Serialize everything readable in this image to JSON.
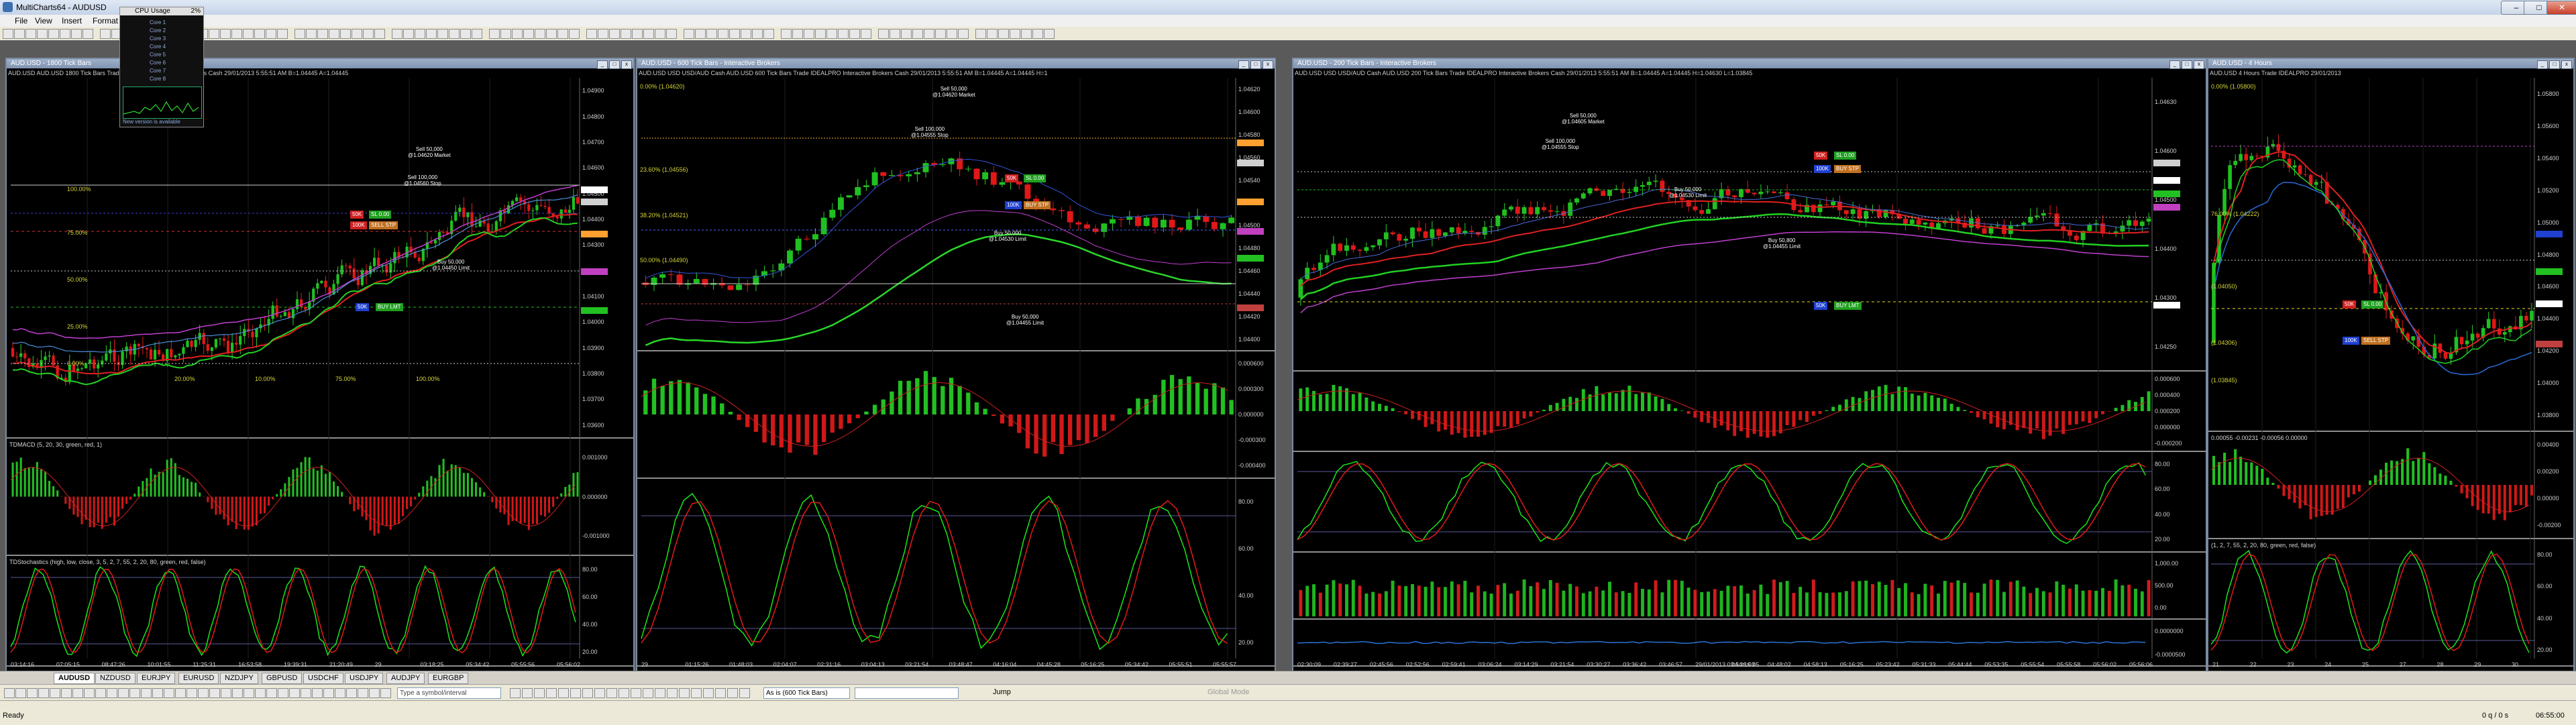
{
  "window": {
    "title": "MultiCharts64 - AUDUSD",
    "min": "–",
    "max": "□",
    "close": "✕"
  },
  "menu": [
    "File",
    "View",
    "Insert",
    "Format"
  ],
  "cpu": {
    "title": "CPU Usage",
    "percent": "2%",
    "rows": [
      "Core 1",
      "Core 2",
      "Core 3",
      "Core 4",
      "Core 5",
      "Core 6",
      "Core 7",
      "Core 8"
    ],
    "footer": "New version is available"
  },
  "charts": [
    {
      "title": "AUD.USD - 1800 Tick Bars",
      "info": "AUD.USD  AUD.USD  1800 Tick Bars   Trade  IDEALPRO  Interactive Brokers  Cash  29/01/2013  5:55:51 AM  B=1.04445  A=1.04445",
      "axis": [
        "1.04900",
        "1.04800",
        "1.04700",
        "1.04600",
        "1.04500",
        "1.04400",
        "1.04300",
        "1.04200",
        "1.04100",
        "1.04000",
        "1.03900",
        "1.03800",
        "1.03700",
        "1.03600"
      ],
      "fib": [
        "100.00%",
        "75.00%",
        "50.00%",
        "25.00%",
        "0.00%"
      ],
      "fibx": [
        "20.00%",
        "10.00%",
        "75.00%",
        "100.00%"
      ],
      "orders": [
        {
          "t": "Sell 50,000",
          "s": "@1.04620 Market"
        },
        {
          "t": "Sell 100,000",
          "s": "@1.04560 Stop"
        },
        {
          "t": "Buy 50,000",
          "s": "@1.04450 Limit"
        }
      ],
      "times": [
        "03:14:16",
        "07:05:15",
        "08:47:26",
        "10:01:55",
        "11:25:31",
        "16:53:58",
        "19:39:31",
        "21:20:49",
        "29",
        "03:18:25",
        "05:34:42",
        "05:55:56",
        "05:56:02"
      ],
      "ind1": "TDMACD (5, 20, 30, green, red, 1)",
      "ind1axis": [
        "0.001000",
        "0.000000",
        "-0.001000"
      ],
      "ind2": "TDStochastics (high, low, close, 3, 5, 2, 7, 55, 2, 20, 80, green, red, false)",
      "ind2axis": [
        "80.00",
        "60.00",
        "40.00",
        "20.00"
      ]
    },
    {
      "title": "AUD.USD - 600 Tick Bars - Interactive Brokers",
      "info": "AUD.USD  USD USD/AUD Cash AUD.USD  600 Tick Bars   Trade  IDEALPRO  Interactive Brokers  Cash  29/01/2013  5:55:51 AM  B=1.04445  A=1.04445  H=1",
      "axis": [
        "1.04620",
        "1.04600",
        "1.04580",
        "1.04560",
        "1.04540",
        "1.04520",
        "1.04500",
        "1.04480",
        "1.04460",
        "1.04440",
        "1.04420",
        "1.04400"
      ],
      "fib": [
        "0.00% (1.04620)",
        "23.60% (1.04556)",
        "38.20% (1.04521)",
        "50.00% (1.04490)"
      ],
      "orders": [
        {
          "t": "Sell 50,000",
          "s": "@1.04620 Market"
        },
        {
          "t": "Sell 100,000",
          "s": "@1.04555 Stop"
        },
        {
          "t": "Buy 50,000",
          "s": "@1.04530 Limit"
        },
        {
          "t": "Buy 50,000",
          "s": "@1.04455 Limit"
        }
      ],
      "times": [
        "29",
        "01:15:26",
        "01:48:03",
        "02:04:07",
        "02:31:16",
        "03:04:13",
        "03:21:54",
        "03:48:47",
        "04:16:04",
        "04:45:28",
        "05:16:25",
        "05:34:42",
        "05:55:51",
        "05:55:57"
      ],
      "ind1axis": [
        "0.000600",
        "0.000300",
        "0.000000",
        "-0.000300",
        "-0.000400"
      ],
      "ind2axis": [
        "80.00",
        "60.00",
        "40.00",
        "20.00"
      ]
    },
    {
      "title": "AUD.USD - 200 Tick Bars - Interactive Brokers",
      "info": "AUD.USD  USD USD/AUD Cash AUD.USD  200 Tick Bars   Trade  IDEALPRO  Interactive Brokers  Cash  29/01/2013  5:55:51 AM  B=1.04445  A=1.04445  H=1.04630  L=1.03845",
      "axis": [
        "1.04630",
        "1.04600",
        "1.04500",
        "1.04400",
        "1.04300",
        "1.04250"
      ],
      "orders": [
        {
          "t": "Sell 50,000",
          "s": "@1.04605 Market"
        },
        {
          "t": "Sell 100,000",
          "s": "@1.04555 Stop"
        },
        {
          "t": "Buy 50,000",
          "s": "@1.04530 Limit"
        },
        {
          "t": "Buy 50,800",
          "s": "@1.04455 Limit"
        }
      ],
      "times": [
        "02:30:09",
        "02:39:27",
        "02:45:56",
        "02:52:56",
        "02:59:41",
        "03:06:24",
        "03:14:29",
        "03:21:54",
        "03:30:27",
        "03:36:42",
        "03:46:57",
        "29/01/2013 03:54:16 05",
        "04:36:03",
        "04:48:02",
        "04:58:13",
        "05:16:25",
        "05:23:42",
        "05:31:33",
        "05:44:44",
        "05:53:35",
        "05:55:54",
        "05:55:58",
        "05:56:02",
        "05:56:06"
      ],
      "ind1axis": [
        "0.000600",
        "0.000400",
        "0.000200",
        "0.000000",
        "-0.000200"
      ],
      "ind2axis": [
        "80.00",
        "60.00",
        "40.00",
        "20.00"
      ],
      "ind3axis": [
        "1,000.00",
        "500.00",
        "0.00"
      ],
      "ind4axis": [
        "0.0000000",
        "-0.0000500"
      ]
    },
    {
      "title": "AUD.USD - 4 Hours",
      "info": "AUD.USD  4 Hours  Trade  IDEALPRO  29/01/2013",
      "axis": [
        "1.05800",
        "1.05600",
        "1.05400",
        "1.05200",
        "1.05000",
        "1.04800",
        "1.04600",
        "1.04400",
        "1.04200",
        "1.04000",
        "1.03800"
      ],
      "fib": [
        "0.00% (1.05800)",
        "76.00% (1.04222)",
        "(1.04050)",
        "(1.04306)",
        "(1.03845)"
      ],
      "ind1": "0.00055  -0.00231  -0.00056  0.00000",
      "ind1axis": [
        "0.00400",
        "0.00200",
        "0.00000",
        "-0.00200"
      ],
      "ind2": "(1, 2, 7, 55, 2, 20, 80, green, red, false)",
      "ind2axis": [
        "80.00",
        "60.00",
        "40.00",
        "20.00"
      ],
      "times": [
        "21",
        "22",
        "23",
        "24",
        "25",
        "27",
        "28",
        "29",
        "30"
      ]
    }
  ],
  "order_tags": {
    "sl": "SL",
    "tp": "TP",
    "qty": "50K",
    "qty2": "100K",
    "buy_stp": "BUY STP",
    "buy_lmt": "BUY LMT",
    "sell_stp": "SELL STP",
    "sell_lmt": "SELL LMT",
    "sl_val": "0.00"
  },
  "tabs": [
    "AUDUSD",
    "NZDUSD",
    "EURJPY",
    "EURUSD",
    "NZDJPY",
    "GBPUSD",
    "USDCHF",
    "USDJPY",
    "AUDJPY",
    "EURGBP"
  ],
  "drawbar": {
    "symbol_placeholder": "Type a symbol/interval",
    "interval": "As is (600 Tick Bars)",
    "jump": "Jump",
    "global_mode": "Global Mode"
  },
  "status": {
    "left": "Ready",
    "right": "0 q / 0 s",
    "time": "06:55:00"
  }
}
